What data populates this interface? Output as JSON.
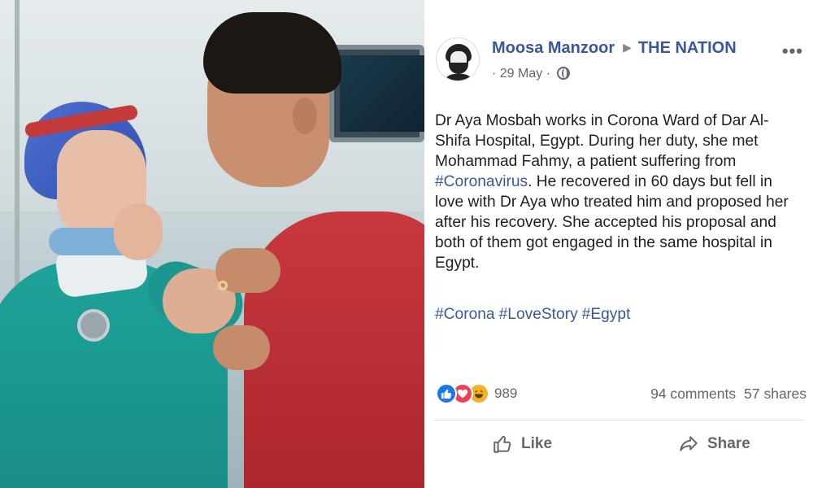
{
  "post": {
    "author": "Moosa Manzoor",
    "page": "THE NATION",
    "date": "29 May",
    "date_prefix": "·",
    "date_suffix": "·",
    "more_menu": "•••",
    "body": {
      "part1": "Dr Aya Mosbah works in Corona Ward of Dar Al-Shifa Hospital, Egypt. During her duty, she met Mohammad Fahmy, a patient suffering from",
      "hashtag_inline": "#Coronavirus",
      "part2": ". He recovered in 60 days but fell in love with Dr Aya who treated him and proposed her after his recovery. She accepted his proposal and both of them got engaged in the same hospital in Egypt."
    },
    "hashtags": [
      "#Corona",
      "#LoveStory",
      "#Egypt"
    ],
    "reactions": {
      "count": "989",
      "icons": [
        "like-reaction",
        "love-reaction",
        "haha-reaction"
      ]
    },
    "comments": "94 comments",
    "shares": "57 shares",
    "actions": {
      "like": "Like",
      "share": "Share"
    }
  },
  "colors": {
    "link": "#385898",
    "meta": "#616770",
    "like_reaction": "#1877f2",
    "love_reaction": "#f33e58",
    "haha_reaction": "#f7b125"
  }
}
